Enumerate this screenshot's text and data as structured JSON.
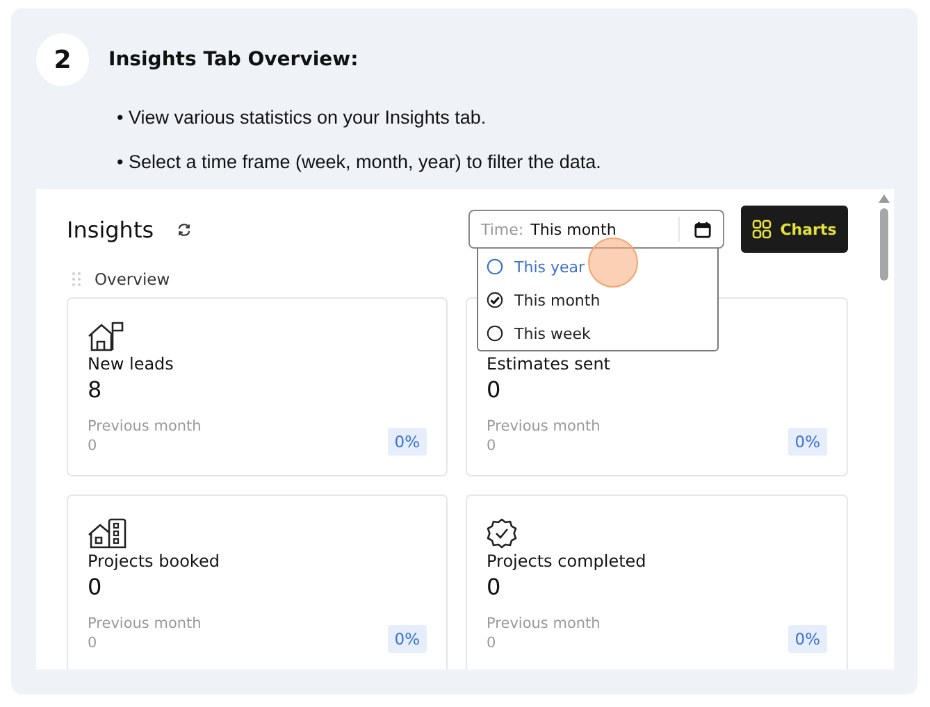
{
  "step": {
    "number": "2",
    "title": "Insights Tab Overview:"
  },
  "bullets": [
    "• View various statistics on your Insights tab.",
    "• Select a time frame (week, month, year) to filter the data."
  ],
  "app": {
    "title": "Insights",
    "time_filter": {
      "label": "Time:",
      "value": "This month"
    },
    "charts_button": "Charts",
    "section": "Overview",
    "dropdown": [
      {
        "label": "This year",
        "selected": false,
        "hovered": true
      },
      {
        "label": "This month",
        "selected": true,
        "hovered": false
      },
      {
        "label": "This week",
        "selected": false,
        "hovered": false
      }
    ],
    "cards": [
      {
        "label": "New leads",
        "value": "8",
        "previous_label": "Previous month",
        "previous_value": "0",
        "change": "0%"
      },
      {
        "label": "Estimates sent",
        "value": "0",
        "previous_label": "Previous month",
        "previous_value": "0",
        "change": "0%"
      },
      {
        "label": "Projects booked",
        "value": "0",
        "previous_label": "Previous month",
        "previous_value": "0",
        "change": "0%"
      },
      {
        "label": "Projects completed",
        "value": "0",
        "previous_label": "Previous month",
        "previous_value": "0",
        "change": "0%"
      }
    ]
  }
}
